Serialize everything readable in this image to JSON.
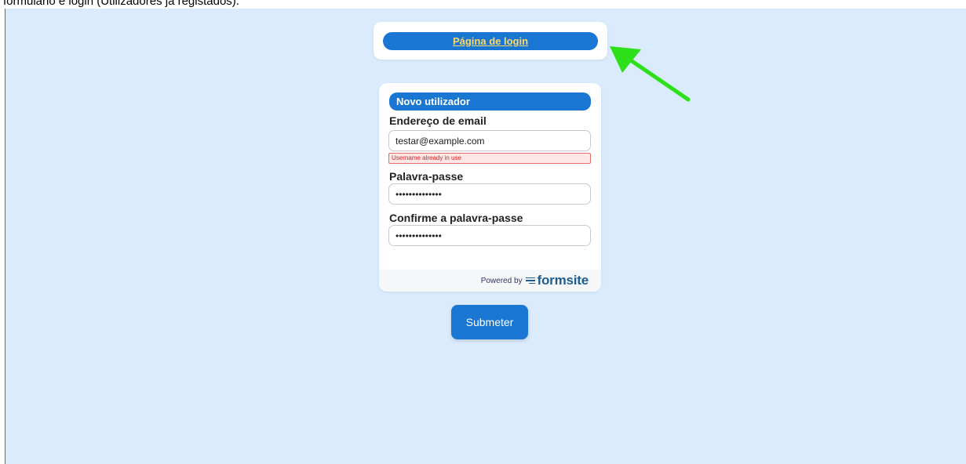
{
  "caption": "formulário e login (Utilizadores já registados).",
  "login_card": {
    "link_label": "Página de login"
  },
  "form": {
    "section_title": "Novo utilizador",
    "email": {
      "label": "Endereço de email",
      "value": "testar@example.com",
      "error": "Username already in use"
    },
    "password": {
      "label": "Palavra-passe",
      "value": "••••••••••••••"
    },
    "confirm_password": {
      "label": "Confirme a palavra-passe",
      "value": "••••••••••••••"
    },
    "footer": {
      "powered_by": "Powered by",
      "brand": "formsite"
    }
  },
  "submit_label": "Submeter",
  "colors": {
    "background": "#d9ebfd",
    "primary": "#1976d2",
    "link": "#ffd966",
    "error_border": "#e06c6c",
    "annotation_arrow": "#2ee01a"
  },
  "icons": {
    "brand_logo": "formsite-lines-icon",
    "annotation": "green-arrow-icon"
  }
}
